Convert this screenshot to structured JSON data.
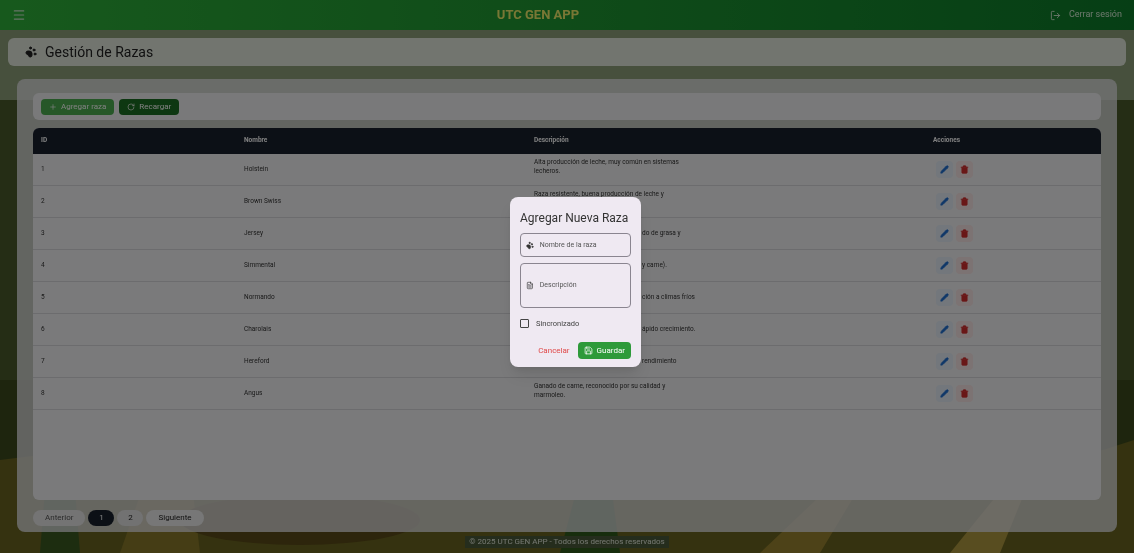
{
  "app_bar": {
    "title": "UTC GEN APP",
    "logout": "Cerrar sesión"
  },
  "page_title": "Gestión de Razas",
  "toolbar": {
    "add": "Agregar raza",
    "reload": "Recargar"
  },
  "table": {
    "columns": [
      "ID",
      "Nombre",
      "Descripción",
      "Acciones"
    ],
    "rows": [
      {
        "id": "1",
        "name": "Holstein",
        "description": "Alta producción de leche, muy común en sistemas lecheros.",
        "kind": "full"
      },
      {
        "id": "2",
        "name": "Brown Swiss",
        "description": "Raza resistente, buena producción de leche y",
        "kind": "full"
      },
      {
        "id": "3",
        "name": "Jersey",
        "description": "do de grasa y",
        "kind": "covered"
      },
      {
        "id": "4",
        "name": "Simmental",
        "description": "y carne).",
        "kind": "covered"
      },
      {
        "id": "5",
        "name": "Normando",
        "description": "ción a climas fríos",
        "kind": "covered"
      },
      {
        "id": "6",
        "name": "Charolais",
        "description": "ápido crecimiento.",
        "kind": "covered"
      },
      {
        "id": "7",
        "name": "Hereford",
        "description": "rendimiento",
        "kind": "covered"
      },
      {
        "id": "8",
        "name": "Angus",
        "description": "Ganado de carne, reconocido por su calidad y marmoleo.",
        "kind": "full"
      }
    ]
  },
  "pagination": {
    "previous": {
      "label": "Anterior",
      "disabled": true
    },
    "pages": [
      {
        "label": "1",
        "selected": true
      },
      {
        "label": "2",
        "selected": false
      }
    ],
    "next": {
      "label": "Siguiente",
      "disabled": false
    }
  },
  "footer": "© 2025 UTC GEN APP - Todos los derechos reservados",
  "dialog": {
    "title": "Agregar Nueva Raza",
    "name_field": {
      "placeholder": "Nombre de la raza"
    },
    "description_field": {
      "placeholder": "Descripción"
    },
    "synced": {
      "label": "Sincronizado",
      "checked": false
    },
    "cancel": "Cancelar",
    "save": "Guardar"
  }
}
